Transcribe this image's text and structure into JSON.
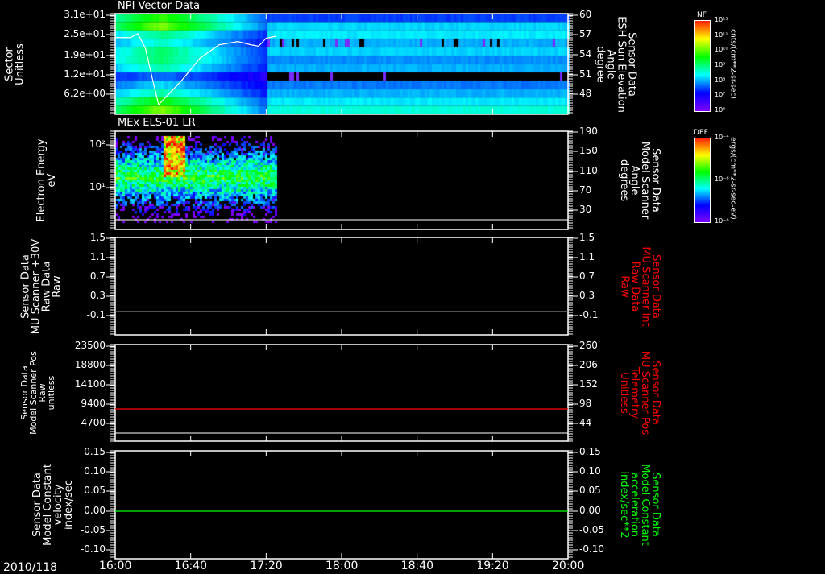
{
  "time_axis": {
    "date": "2010/118",
    "labels": [
      "16:00",
      "16:40",
      "17:20",
      "18:00",
      "18:40",
      "19:20",
      "20:00"
    ]
  },
  "colors": {
    "background": "#000000",
    "axis": "#ffffff",
    "red_trace": "#ff0000",
    "green_trace": "#00ff00",
    "grey_trace": "#808080"
  },
  "chart_data": [
    {
      "type": "heatmap",
      "title": "NPI Vector Data",
      "ylabel": "Sector\nUnitless",
      "yticks": [
        "3.1e+01",
        "2.5e+01",
        "1.9e+01",
        "1.2e+01",
        "6.2e+00"
      ],
      "y2label": "Sensor Data\nESH Sun Elevation\nAngle\ndegree",
      "y2ticks": [
        "60",
        "57",
        "54",
        "51",
        "48"
      ],
      "y2lim": [
        46,
        60
      ],
      "colorbar": {
        "label": "NF",
        "units": "cnts/(cm**2-sr-sec)",
        "ticks": [
          "10¹²",
          "10¹¹",
          "10¹⁰",
          "10⁹",
          "10⁸",
          "10⁷",
          "10⁶"
        ]
      },
      "overlay_line": {
        "name": "ESH Sun Elevation Angle",
        "color": "#ffffff",
        "x": [
          "16:00",
          "16:08",
          "16:12",
          "16:16",
          "16:20",
          "16:23",
          "16:35",
          "16:45",
          "16:55",
          "17:05",
          "17:12",
          "17:16",
          "17:20",
          "17:25"
        ],
        "y": [
          56.6,
          56.6,
          57.2,
          55.0,
          50.0,
          46.4,
          50.0,
          53.5,
          55.5,
          56.0,
          55.5,
          55.3,
          56.5,
          56.8
        ]
      }
    },
    {
      "type": "heatmap",
      "title": "MEx ELS-01 LR",
      "ylabel": "Electron Energy\neV",
      "yticks": [
        "10²",
        "10¹"
      ],
      "yscale": "log",
      "y2label": "Sensor Data\nModel Scanner\nAngle\ndegrees",
      "y2ticks": [
        "190",
        "150",
        "110",
        "70",
        "30"
      ],
      "colorbar": {
        "label": "DEF",
        "units": "ergs/(cm**2-sr-sec-eV)",
        "ticks": [
          "10⁻⁴",
          "10⁻⁶",
          "10⁻⁸"
        ]
      },
      "data_range": [
        "16:00",
        "17:25"
      ]
    },
    {
      "type": "line",
      "ylabel": "Sensor Data\nMU Scanner +30V\nRaw Data\nRaw",
      "yticks": [
        "1.5",
        "1.1",
        "0.7",
        "0.3",
        "-0.1"
      ],
      "ylim": [
        -0.1,
        1.5
      ],
      "y2label": "Sensor Data\nMU Scanner Int\nRaw Data\nRaw",
      "y2ticks": [
        "1.5",
        "1.1",
        "0.7",
        "0.3",
        "-0.1"
      ],
      "series": [
        {
          "x": [
            "16:00",
            "20:00"
          ],
          "y": [
            0.0,
            0.0
          ],
          "color": "#808080"
        }
      ]
    },
    {
      "type": "line",
      "ylabel": "Sensor Data\nModel Scanner Pos\nRaw\nunitless",
      "yticks": [
        "23500",
        "18800",
        "14100",
        "9400",
        "4700"
      ],
      "ylim": [
        0,
        23500
      ],
      "y2label": "Sensor Data\nMU Scanner Pos\nTelemetry\nUnitless",
      "y2ticks": [
        "260",
        "206",
        "152",
        "98",
        "44"
      ],
      "series": [
        {
          "x": [
            "16:00",
            "20:00"
          ],
          "y": [
            8200,
            8200
          ],
          "color": "#ff0000"
        }
      ]
    },
    {
      "type": "line",
      "ylabel": "Sensor Data\nModel Constant\nvelocity\nindex/sec",
      "yticks": [
        "0.15",
        "0.10",
        "0.05",
        "0.00",
        "-0.05",
        "-0.10"
      ],
      "ylim": [
        -0.1,
        0.15
      ],
      "y2label": "Sensor Data\nModel Constant\nacceleration\nindex/sec**2",
      "y2ticks": [
        "0.15",
        "0.10",
        "0.05",
        "0.00",
        "-0.05",
        "-0.10"
      ],
      "series": [
        {
          "x": [
            "16:00",
            "20:00"
          ],
          "y": [
            0.0,
            0.0
          ],
          "color": "#00ff00"
        }
      ]
    }
  ]
}
